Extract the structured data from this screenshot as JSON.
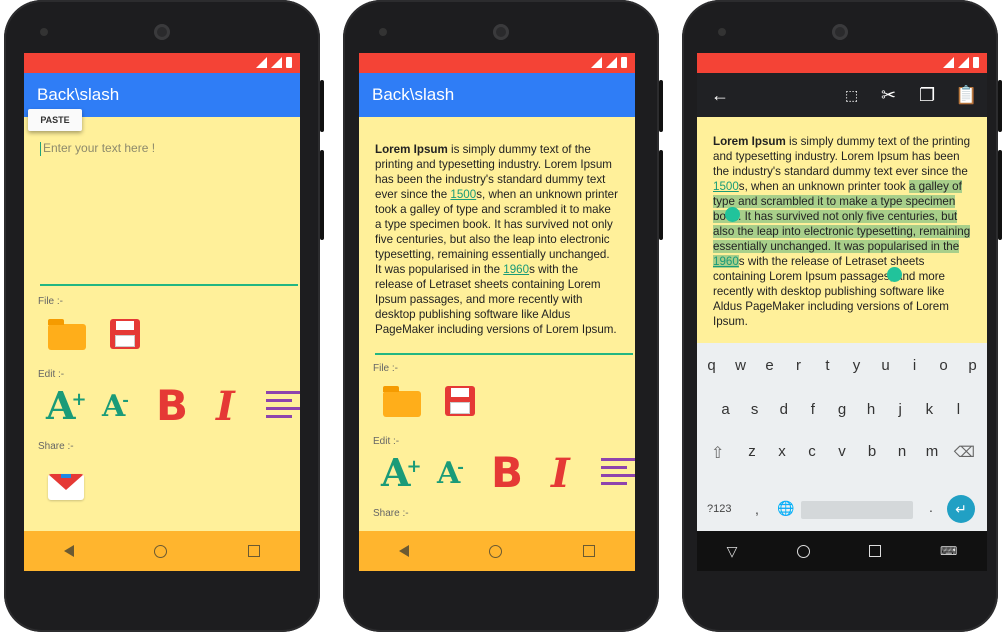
{
  "app": {
    "title": "Back\\slash",
    "paste_label": "PASTE",
    "input_placeholder": "Enter your text here !",
    "labels": {
      "file": "File :-",
      "edit": "Edit :-",
      "share": "Share :-"
    }
  },
  "lorem": {
    "bold": "Lorem Ipsum",
    "part1": " is simply dummy text of the printing and typesetting industry. Lorem Ipsum has been the industry's standard dummy text ever since the ",
    "link1": "1500",
    "part2": "s, when an unknown printer took a galley of type and scrambled it to make a type specimen book. It has survived not only five centuries, but also the leap into electronic typesetting, remaining essentially unchanged. It was popularised in the ",
    "link2": "1960",
    "part3": "s with the release of Letraset sheets containing Lorem Ipsum passages, and more recently with desktop publishing software like Aldus PageMaker including versions of Lorem Ipsum.",
    "p3_pre_sel": " is simply dummy text of the printing and typesetting industry. Lorem Ipsum has been the industry's standard dummy text ever since the ",
    "p3_mid": "s, when an unknown printer took ",
    "p3_selected": "a galley of type and scrambled it to make a type specimen book. It has survived not only five centuries, but also the leap into electronic typesetting, remaining essentially unchanged. It was popularised in the ",
    "p3_sel_link": "1960",
    "p3_after": "s with the release of Letraset sheets containing Lorem Ipsum passages, and more recently with desktop publishing software like Aldus PageMaker including versions of Lorem Ipsum."
  },
  "keyboard": {
    "row1": [
      "q",
      "w",
      "e",
      "r",
      "t",
      "y",
      "u",
      "i",
      "o",
      "p"
    ],
    "row2": [
      "a",
      "s",
      "d",
      "f",
      "g",
      "h",
      "j",
      "k",
      "l"
    ],
    "row3": [
      "z",
      "x",
      "c",
      "v",
      "b",
      "n",
      "m"
    ],
    "sym": "?123",
    "comma": ",",
    "period": "."
  },
  "icons": {
    "folder": "folder-icon",
    "save": "floppy-save-icon",
    "increase": "font-increase-icon",
    "decrease": "font-decrease-icon",
    "bold": "bold-icon",
    "italic": "italic-icon",
    "align": "align-left-icon",
    "gmail": "gmail-share-icon"
  },
  "glyphs": {
    "a": "A",
    "plus": "+",
    "minus": "-",
    "b": "B",
    "i": "I"
  },
  "colors": {
    "statusbar": "#f44336",
    "appbar": "#2f7df6",
    "background": "#fff09a",
    "navbar": "#ffb52e",
    "accent": "#1a9b78"
  }
}
